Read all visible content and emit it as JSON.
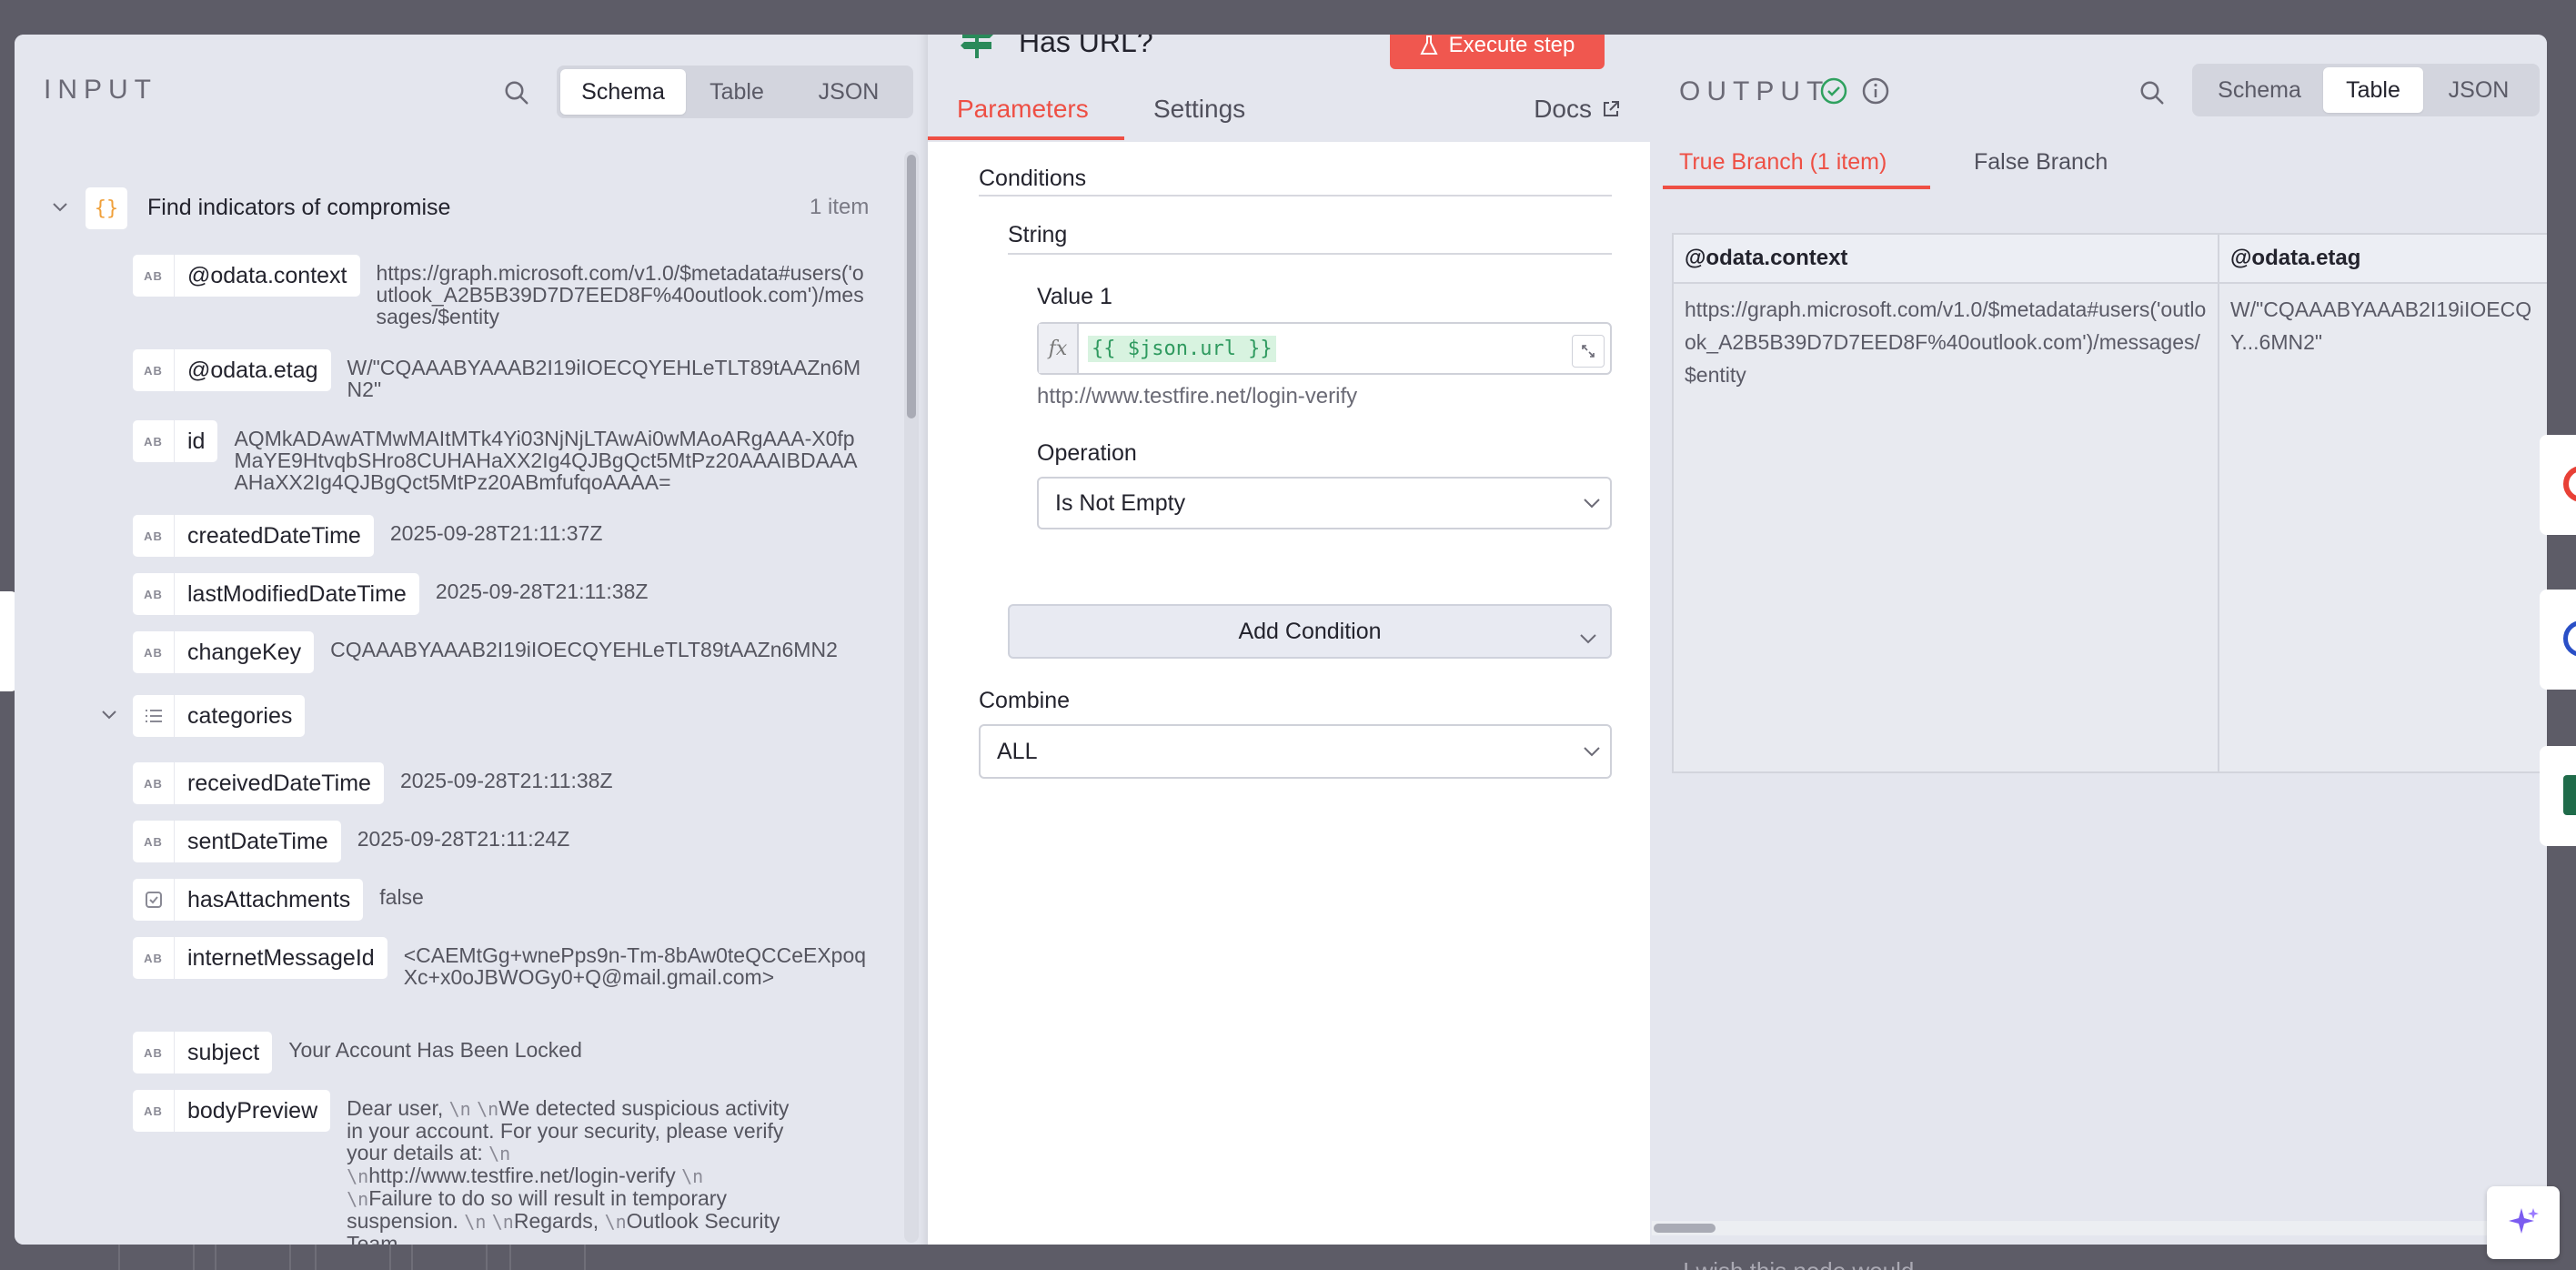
{
  "input": {
    "title": "INPUT",
    "view_tabs": [
      "Schema",
      "Table",
      "JSON"
    ],
    "root": {
      "label": "Find indicators of compromise",
      "count": "1 item"
    },
    "type_string": "AB",
    "fields": [
      {
        "key": "@odata.context",
        "value": "https://graph.microsoft.com/v1.0/$metadata#users('outlook_A2B5B39D7D7EED8F%40outlook.com')/messages/$entity"
      },
      {
        "key": "@odata.etag",
        "value": "W/\"CQAAABYAAAB2I19iIOECQYEHLeTLT89tAAZn6MN2\""
      },
      {
        "key": "id",
        "value": "AQMkADAwATMwMAItMTk4Yi03NjNjLTAwAi0wMAoARgAAA-X0fpMaYE9HtvqbSHro8CUHAHaXX2Ig4QJBgQct5MtPz20AAAIBDAAAAHaXX2Ig4QJBgQct5MtPz20ABmfufqoAAAA="
      },
      {
        "key": "createdDateTime",
        "value": "2025-09-28T21:11:37Z"
      },
      {
        "key": "lastModifiedDateTime",
        "value": "2025-09-28T21:11:38Z"
      },
      {
        "key": "changeKey",
        "value": "CQAAABYAAAB2I19iIOECQYEHLeTLT89tAAZn6MN2"
      },
      {
        "key": "categories",
        "value": ""
      },
      {
        "key": "receivedDateTime",
        "value": "2025-09-28T21:11:38Z"
      },
      {
        "key": "sentDateTime",
        "value": "2025-09-28T21:11:24Z"
      },
      {
        "key": "hasAttachments",
        "value": "false"
      },
      {
        "key": "internetMessageId",
        "value": "<CAEMtGg+wnePps9n-Tm-8bAw0teQCCeEXpoqXc+x0oJBWOGy0+Q@mail.gmail.com>"
      },
      {
        "key": "subject",
        "value": "Your Account Has Been Locked"
      },
      {
        "key": "bodyPreview",
        "value": ""
      }
    ],
    "body_preview": {
      "l1": "Dear user,",
      "l2": "We detected suspicious activity",
      "l3": "in your account. For your security, please verify",
      "l4": "your details at:",
      "l5": "http://www.testfire.net/login-verify",
      "l6": "Failure to do so will result in temporary",
      "l7": "suspension.",
      "l8": "Regards,",
      "l9": "Outlook Security",
      "l10": "Team",
      "nl": "\\n"
    }
  },
  "node": {
    "title": "Has URL?",
    "execute_label": "Execute step",
    "tabs": [
      "Parameters",
      "Settings"
    ],
    "docs_label": "Docs",
    "conditions_label": "Conditions",
    "string_label": "String",
    "value1_label": "Value 1",
    "value1_expr": "{{ $json.url }}",
    "value1_fx": "fx",
    "value1_resolved": "http://www.testfire.net/login-verify",
    "operation_label": "Operation",
    "operation_value": "Is Not Empty",
    "add_condition_label": "Add Condition",
    "combine_label": "Combine",
    "combine_value": "ALL"
  },
  "output": {
    "title": "OUTPUT",
    "view_tabs": [
      "Schema",
      "Table",
      "JSON"
    ],
    "branches": [
      "True Branch (1 item)",
      "False Branch"
    ],
    "columns": [
      "@odata.context",
      "@odata.etag"
    ],
    "row": [
      "https://graph.microsoft.com/v1.0/$metadata#users('outlook_A2B5B39D7D7EED8F%40outlook.com')/messages/$entity",
      "W/\"CQAAABYAAAB2I19iIOECQY...6MN2\""
    ]
  },
  "background": {
    "footer_text": "I wish this node would..."
  },
  "colors": {
    "accent": "#ee4f44",
    "success": "#2fa15f",
    "node_icon": "#2a8a5a"
  }
}
